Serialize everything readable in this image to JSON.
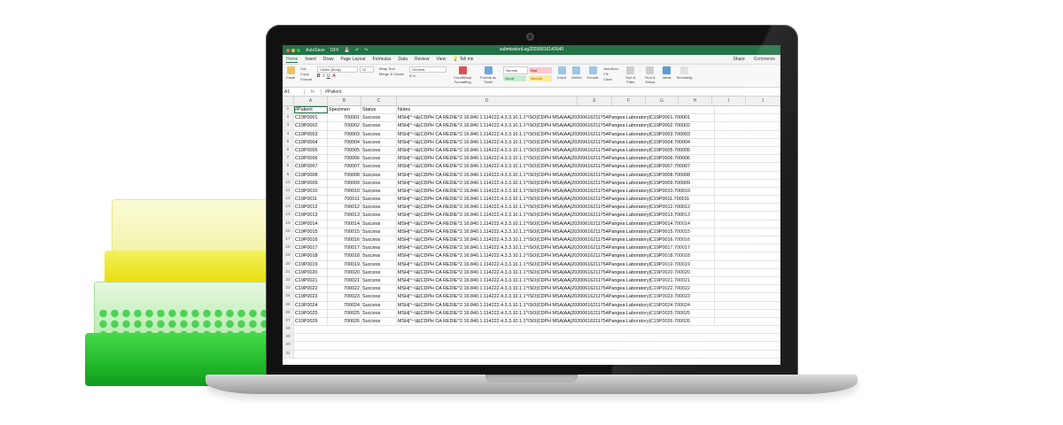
{
  "window": {
    "title": "submissionLog20200616141640",
    "autosave_label": "AutoSave",
    "autosave_state": "OFF"
  },
  "ribbon_tabs": [
    "Home",
    "Insert",
    "Draw",
    "Page Layout",
    "Formulas",
    "Data",
    "Review",
    "View",
    "Tell me"
  ],
  "ribbon_right": {
    "share": "Share",
    "comments": "Comments"
  },
  "ribbon": {
    "paste": "Paste",
    "cut": "Cut",
    "copy": "Copy",
    "format": "Format",
    "font_name": "Calibri (Body)",
    "font_size": "12",
    "wrap_text": "Wrap Text",
    "merge_center": "Merge & Center",
    "number_format": "General",
    "conditional_formatting": "Conditional Formatting",
    "format_as_table": "Format as Table",
    "style_normal": "Normal",
    "style_bad": "Bad",
    "style_good": "Good",
    "style_neutral": "Neutral",
    "insert": "Insert",
    "delete": "Delete",
    "format_cells": "Format",
    "autosum": "AutoSum",
    "fill": "Fill",
    "clear": "Clear",
    "sort_filter": "Sort & Filter",
    "find_select": "Find & Select",
    "ideas": "Ideas",
    "sensitivity": "Sensitivity"
  },
  "formula_bar": {
    "cell_ref": "A1",
    "fx": "fx",
    "content": "#Patient"
  },
  "columns": [
    "A",
    "B",
    "C",
    "D",
    "E",
    "F",
    "G",
    "H",
    "I",
    "J"
  ],
  "headers": {
    "row_num": "1",
    "patient": "#Patient",
    "specimen": "Specimen",
    "status": "Status",
    "notes": "Notes"
  },
  "rows": [
    {
      "n": "2",
      "patient": "C19P0001",
      "specimen": "700001",
      "status": "Success",
      "notes": "MSH|^~\\&|CDPH CA REDIE^2.16.840.1.114222.4.3.3.10.1.1^ISO|CDPH MSA|AA|20200616211754Pangea Laboratory|C19P0001.700001"
    },
    {
      "n": "3",
      "patient": "C19P0002",
      "specimen": "700002",
      "status": "Success",
      "notes": "MSH|^~\\&|CDPH CA REDIE^2.16.840.1.114222.4.3.3.10.1.1^ISO|CDPH MSA|AA|20200616211754Pangea Laboratory|C19P0002.700002"
    },
    {
      "n": "4",
      "patient": "C19P0003",
      "specimen": "700003",
      "status": "Success",
      "notes": "MSH|^~\\&|CDPH CA REDIE^2.16.840.1.114222.4.3.3.10.1.1^ISO|CDPH MSA|AA|20200616211754Pangea Laboratory|C19P0003.700003"
    },
    {
      "n": "5",
      "patient": "C19P0004",
      "specimen": "700004",
      "status": "Success",
      "notes": "MSH|^~\\&|CDPH CA REDIE^2.16.840.1.114222.4.3.3.10.1.1^ISO|CDPH MSA|AA|20200616211754Pangea Laboratory|C19P0004.700004"
    },
    {
      "n": "6",
      "patient": "C19P0005",
      "specimen": "700005",
      "status": "Success",
      "notes": "MSH|^~\\&|CDPH CA REDIE^2.16.840.1.114222.4.3.3.10.1.1^ISO|CDPH MSA|AA|20200616211754Pangea Laboratory|C19P0005.700005"
    },
    {
      "n": "7",
      "patient": "C19P0006",
      "specimen": "700006",
      "status": "Success",
      "notes": "MSH|^~\\&|CDPH CA REDIE^2.16.840.1.114222.4.3.3.10.1.1^ISO|CDPH MSA|AA|20200616211754Pangea Laboratory|C19P0006.700006"
    },
    {
      "n": "8",
      "patient": "C19P0007",
      "specimen": "700007",
      "status": "Success",
      "notes": "MSH|^~\\&|CDPH CA REDIE^2.16.840.1.114222.4.3.3.10.1.1^ISO|CDPH MSA|AA|20200616211754Pangea Laboratory|C19P0007.700007"
    },
    {
      "n": "9",
      "patient": "C19P0008",
      "specimen": "700008",
      "status": "Success",
      "notes": "MSH|^~\\&|CDPH CA REDIE^2.16.840.1.114222.4.3.3.10.1.1^ISO|CDPH MSA|AA|20200616211754Pangea Laboratory|C19P0008.700008"
    },
    {
      "n": "10",
      "patient": "C19P0009",
      "specimen": "700009",
      "status": "Success",
      "notes": "MSH|^~\\&|CDPH CA REDIE^2.16.840.1.114222.4.3.3.10.1.1^ISO|CDPH MSA|AA|20200616211754Pangea Laboratory|C19P0009.700009"
    },
    {
      "n": "11",
      "patient": "C19P0010",
      "specimen": "700010",
      "status": "Success",
      "notes": "MSH|^~\\&|CDPH CA REDIE^2.16.840.1.114222.4.3.3.10.1.1^ISO|CDPH MSA|AA|20200616211754Pangea Laboratory|C19P0010.700010"
    },
    {
      "n": "12",
      "patient": "C19P0011",
      "specimen": "700011",
      "status": "Success",
      "notes": "MSH|^~\\&|CDPH CA REDIE^2.16.840.1.114222.4.3.3.10.1.1^ISO|CDPH MSA|AA|20200616211754Pangea Laboratory|C19P0011.700011"
    },
    {
      "n": "13",
      "patient": "C19P0012",
      "specimen": "700012",
      "status": "Success",
      "notes": "MSH|^~\\&|CDPH CA REDIE^2.16.840.1.114222.4.3.3.10.1.1^ISO|CDPH MSA|AA|20200616211754Pangea Laboratory|C19P0012.700012"
    },
    {
      "n": "14",
      "patient": "C19P0013",
      "specimen": "700013",
      "status": "Success",
      "notes": "MSH|^~\\&|CDPH CA REDIE^2.16.840.1.114222.4.3.3.10.1.1^ISO|CDPH MSA|AA|20200616211754Pangea Laboratory|C19P0013.700013"
    },
    {
      "n": "15",
      "patient": "C19P0014",
      "specimen": "700014",
      "status": "Success",
      "notes": "MSH|^~\\&|CDPH CA REDIE^2.16.840.1.114222.4.3.3.10.1.1^ISO|CDPH MSA|AA|20200616211754Pangea Laboratory|C19P0014.700014"
    },
    {
      "n": "16",
      "patient": "C19P0015",
      "specimen": "700015",
      "status": "Success",
      "notes": "MSH|^~\\&|CDPH CA REDIE^2.16.840.1.114222.4.3.3.10.1.1^ISO|CDPH MSA|AA|20200616211754Pangea Laboratory|C19P0015.700015"
    },
    {
      "n": "17",
      "patient": "C19P0016",
      "specimen": "700016",
      "status": "Success",
      "notes": "MSH|^~\\&|CDPH CA REDIE^2.16.840.1.114222.4.3.3.10.1.1^ISO|CDPH MSA|AA|20200616211754Pangea Laboratory|C19P0016.700016"
    },
    {
      "n": "18",
      "patient": "C19P0017",
      "specimen": "700017",
      "status": "Success",
      "notes": "MSH|^~\\&|CDPH CA REDIE^2.16.840.1.114222.4.3.3.10.1.1^ISO|CDPH MSA|AA|20200616211754Pangea Laboratory|C19P0017.700017"
    },
    {
      "n": "19",
      "patient": "C19P0018",
      "specimen": "700018",
      "status": "Success",
      "notes": "MSH|^~\\&|CDPH CA REDIE^2.16.840.1.114222.4.3.3.10.1.1^ISO|CDPH MSA|AA|20200616211754Pangea Laboratory|C19P0018.700018"
    },
    {
      "n": "20",
      "patient": "C19P0019",
      "specimen": "700019",
      "status": "Success",
      "notes": "MSH|^~\\&|CDPH CA REDIE^2.16.840.1.114222.4.3.3.10.1.1^ISO|CDPH MSA|AA|20200616211754Pangea Laboratory|C19P0019.700019"
    },
    {
      "n": "21",
      "patient": "C19P0020",
      "specimen": "700020",
      "status": "Success",
      "notes": "MSH|^~\\&|CDPH CA REDIE^2.16.840.1.114222.4.3.3.10.1.1^ISO|CDPH MSA|AA|20200616211754Pangea Laboratory|C19P0020.700020"
    },
    {
      "n": "22",
      "patient": "C19P0021",
      "specimen": "700021",
      "status": "Success",
      "notes": "MSH|^~\\&|CDPH CA REDIE^2.16.840.1.114222.4.3.3.10.1.1^ISO|CDPH MSA|AA|20200616211754Pangea Laboratory|C19P0021.700021"
    },
    {
      "n": "23",
      "patient": "C19P0022",
      "specimen": "700022",
      "status": "Success",
      "notes": "MSH|^~\\&|CDPH CA REDIE^2.16.840.1.114222.4.3.3.10.1.1^ISO|CDPH MSA|AA|20200616211754Pangea Laboratory|C19P0022.700022"
    },
    {
      "n": "24",
      "patient": "C19P0023",
      "specimen": "700023",
      "status": "Success",
      "notes": "MSH|^~\\&|CDPH CA REDIE^2.16.840.1.114222.4.3.3.10.1.1^ISO|CDPH MSA|AA|20200616211754Pangea Laboratory|C19P0023.700023"
    },
    {
      "n": "25",
      "patient": "C19P0024",
      "specimen": "700024",
      "status": "Success",
      "notes": "MSH|^~\\&|CDPH CA REDIE^2.16.840.1.114222.4.3.3.10.1.1^ISO|CDPH MSA|AA|20200616211754Pangea Laboratory|C19P0024.700024"
    },
    {
      "n": "26",
      "patient": "C19P0025",
      "specimen": "700025",
      "status": "Success",
      "notes": "MSH|^~\\&|CDPH CA REDIE^2.16.840.1.114222.4.3.3.10.1.1^ISO|CDPH MSA|AA|20200616211754Pangea Laboratory|C19P0025.700025"
    },
    {
      "n": "27",
      "patient": "C19P0026",
      "specimen": "700026",
      "status": "Success",
      "notes": "MSH|^~\\&|CDPH CA REDIE^2.16.840.1.114222.4.3.3.10.1.1^ISO|CDPH MSA|AA|20200616211754Pangea Laboratory|C19P0026.700026"
    }
  ],
  "empty_rows": [
    "28",
    "29",
    "30",
    "31"
  ],
  "colors": {
    "excel_green": "#217346",
    "style_bad": "#ffc7ce",
    "style_good": "#c6efce",
    "style_neutral": "#ffeb9c"
  }
}
